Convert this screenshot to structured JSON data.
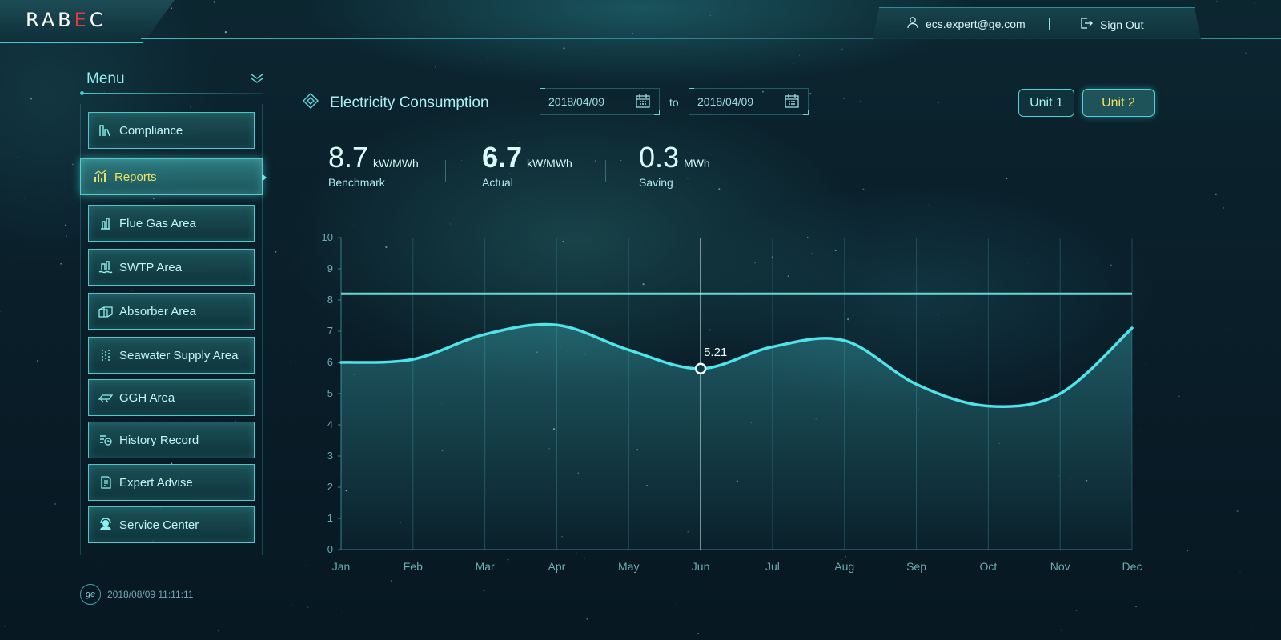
{
  "app": {
    "logo_prefix": "RAB",
    "logo_accent": "E",
    "logo_suffix": "C",
    "user_email": "ecs.expert@ge.com",
    "sign_out": "Sign Out"
  },
  "menu": {
    "title": "Menu",
    "items": [
      {
        "label": "Compliance",
        "icon": "compliance-icon"
      },
      {
        "label": "Reports",
        "icon": "reports-icon",
        "active": true
      },
      {
        "label": "Flue Gas Area",
        "icon": "flue-gas-icon"
      },
      {
        "label": "SWTP Area",
        "icon": "swtp-icon"
      },
      {
        "label": "Absorber Area",
        "icon": "absorber-icon"
      },
      {
        "label": "Seawater Supply Area",
        "icon": "seawater-icon"
      },
      {
        "label": "GGH Area",
        "icon": "ggh-icon"
      },
      {
        "label": "History Record",
        "icon": "history-icon"
      },
      {
        "label": "Expert Advise",
        "icon": "expert-icon"
      },
      {
        "label": "Service Center",
        "icon": "service-icon"
      }
    ],
    "timestamp": "2018/08/09  11:11:11"
  },
  "header": {
    "title": "Electricity Consumption",
    "date_from": "2018/04/09",
    "to_label": "to",
    "date_to": "2018/04/09",
    "unit1": "Unit 1",
    "unit2": "Unit 2"
  },
  "stats": {
    "benchmark_value": "8.7",
    "benchmark_unit": "kW/MWh",
    "benchmark_label": "Benchmark",
    "actual_value": "6.7",
    "actual_unit": "kW/MWh",
    "actual_label": "Actual",
    "saving_value": "0.3",
    "saving_unit": "MWh",
    "saving_label": "Saving"
  },
  "chart_data": {
    "type": "line",
    "categories": [
      "Jan",
      "Feb",
      "Mar",
      "Apr",
      "May",
      "Jun",
      "Jul",
      "Aug",
      "Sep",
      "Oct",
      "Nov",
      "Dec"
    ],
    "series": [
      {
        "values": [
          6.0,
          6.1,
          6.9,
          7.2,
          6.4,
          5.8,
          6.5,
          6.7,
          5.3,
          4.6,
          5.0,
          7.1
        ]
      }
    ],
    "benchmark": 8.2,
    "ylim": [
      0,
      10
    ],
    "yticks": [
      0,
      1,
      2,
      3,
      4,
      5,
      6,
      7,
      8,
      9,
      10
    ],
    "highlight": {
      "index": 5,
      "label": "5.21"
    },
    "colors": {
      "line": "#4fe3ea",
      "benchmark": "#63d9d4",
      "grid": "#2c6670"
    }
  }
}
